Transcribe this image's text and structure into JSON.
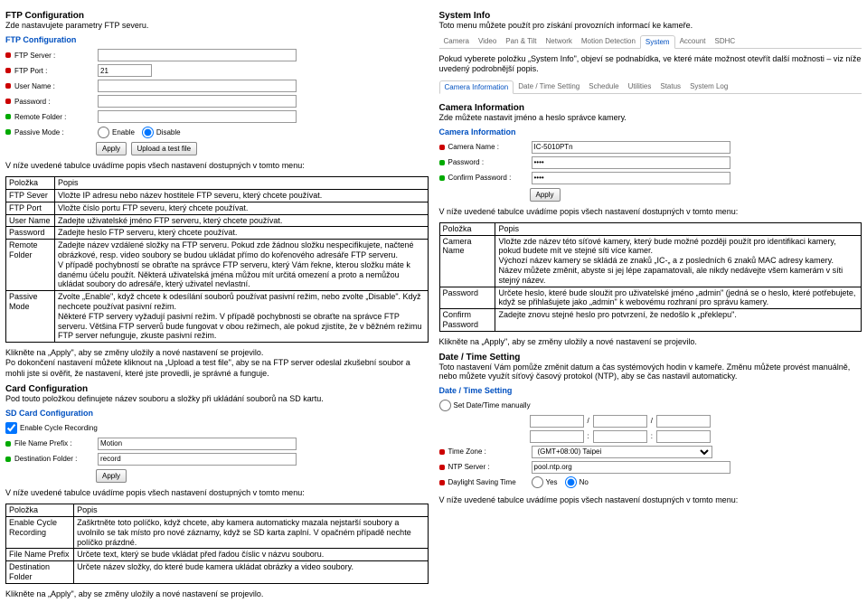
{
  "left": {
    "ftp": {
      "title": "FTP Configuration",
      "sub": "Zde nastavujete parametry FTP severu.",
      "panel": "FTP Configuration",
      "labels": {
        "server": "FTP Server :",
        "port": "FTP Port :",
        "user": "User Name :",
        "password": "Password :",
        "remote": "Remote Folder :",
        "passive": "Passive Mode :"
      },
      "values": {
        "port": "21"
      },
      "radio": {
        "enable": "Enable",
        "disable": "Disable"
      },
      "buttons": {
        "apply": "Apply",
        "test": "Upload a test file"
      },
      "intro": "V níže uvedené tabulce uvádíme popis všech nastavení dostupných v tomto menu:",
      "h_col": "Položka",
      "h_desc": "Popis",
      "rows": [
        [
          "FTP Sever",
          "Vložte IP adresu nebo název hostitele FTP severu, který chcete používat."
        ],
        [
          "FTP Port",
          "Vložte číslo portu FTP severu, který chcete používat."
        ],
        [
          "User Name",
          "Zadejte uživatelské jméno FTP serveru, který chcete používat."
        ],
        [
          "Password",
          "Zadejte heslo FTP serveru, který chcete používat."
        ],
        [
          "Remote Folder",
          "Zadejte název vzdálené složky na FTP serveru. Pokud zde žádnou složku nespecifikujete, načtené obrázkové, resp. video soubory se budou ukládat přímo do kořenového adresáře FTP serveru.\nV případě pochybností se obraťte na správce FTP serveru, který Vám řekne, kterou složku máte k danému účelu použít. Některá uživatelská jména můžou mít určitá omezení a proto a nemůžou ukládat soubory do adresáře, který uživatel nevlastní."
        ],
        [
          "Passive Mode",
          "Zvolte „Enable\", když chcete k odesílání souborů používat pasivní režim, nebo zvolte „Disable\". Když nechcete používat pasivní režim.\nNěkteré FTP servery vyžadují pasivní režim. V případě pochybnosti se obraťte na správce FTP serveru. Většina FTP serverů bude fungovat v obou režimech, ale pokud zjistíte, že v běžném režimu FTP server nefunguje, zkuste pasivní režim."
        ]
      ],
      "footer": "Klikněte na „Apply\", aby se změny uložily a nové nastavení se projevilo.\nPo dokončení nastavení můžete kliknout na „Upload a test file\", aby se na FTP server odeslal zkušební soubor a mohli jste si ověřit, že nastavení, které jste provedli, je správné a funguje."
    },
    "sd": {
      "title": "Card Configuration",
      "sub": "Pod touto položkou definujete název souboru a složky při ukládání souborů na SD kartu.",
      "panel": "SD Card Configuration",
      "check": "Enable Cycle Recording",
      "labels": {
        "prefix": "File Name Prefix :",
        "dest": "Destination Folder :"
      },
      "values": {
        "prefix": "Motion",
        "dest": "record"
      },
      "button": "Apply",
      "intro": "V níže uvedené tabulce uvádíme popis všech nastavení dostupných v tomto menu:",
      "h_col": "Položka",
      "h_desc": "Popis",
      "rows": [
        [
          "Enable Cycle Recording",
          "Zaškrtněte toto políčko, když chcete, aby kamera automaticky mazala nejstarší soubory a uvolnilo se tak místo pro nové záznamy, když se SD karta zaplní. V opačném případě nechte políčko prázdné."
        ],
        [
          "File Name Prefix",
          "Určete text, který se bude vkládat před řadou číslic v názvu souboru."
        ],
        [
          "Destination Folder",
          "Určete název složky, do které bude kamera ukládat obrázky a video soubory."
        ]
      ],
      "footer": "Klikněte na „Apply\", aby se změny uložily a nové nastavení se projevilo."
    }
  },
  "right": {
    "sys": {
      "title": "System Info",
      "sub": "Toto menu můžete použít pro získání provozních informací ke kameře.",
      "tabs1": [
        "Camera",
        "Video",
        "Pan & Tilt",
        "Network",
        "Motion Detection",
        "System",
        "Account",
        "SDHC"
      ],
      "note": "Pokud vyberete položku „System Info\", objeví se podnabídka, ve které máte možnost otevřít další možnosti – viz níže uvedený podrobnější popis.",
      "tabs2": [
        "Camera Information",
        "Date / Time Setting",
        "Schedule",
        "Utilities",
        "Status",
        "System Log"
      ]
    },
    "cam": {
      "title": "Camera Information",
      "sub": "Zde můžete nastavit jméno a heslo správce kamery.",
      "panel": "Camera Information",
      "labels": {
        "name": "Camera Name :",
        "pass": "Password :",
        "confirm": "Confirm Password :"
      },
      "values": {
        "name": "IC-5010PTn",
        "pass": "••••",
        "confirm": "••••"
      },
      "button": "Apply",
      "intro": "V níže uvedené tabulce uvádíme popis všech nastavení dostupných v tomto menu:",
      "h_col": "Položka",
      "h_desc": "Popis",
      "rows": [
        [
          "Camera Name",
          "Vložte zde název této síťové kamery, který bude možné později použít pro identifikaci kamery, pokud budete mít ve stejné síti více kamer.\nVýchozí název kamery se skládá ze znaků „IC-„ a z posledních 6 znaků MAC adresy kamery. Název můžete změnit, abyste si jej lépe zapamatovali, ale nikdy nedávejte všem kamerám v síti stejný název."
        ],
        [
          "Password",
          "Určete heslo, které bude sloužit pro uživatelské jméno „admin\" (jedná se o heslo, které potřebujete, když se přihlašujete jako „admin\" k webovému rozhraní pro správu kamery."
        ],
        [
          "Confirm Password",
          "Zadejte znovu stejné heslo pro potvrzení, že nedošlo k „překlepu\"."
        ]
      ],
      "footer": "Klikněte na „Apply\", aby se změny uložily a nové nastavení se projevilo."
    },
    "dt": {
      "title": "Date / Time Setting",
      "sub": "Toto nastavení Vám pomůže změnit datum a čas systémových hodin v kameře. Změnu můžete provést manuálně, nebo můžete využít síťový časový protokol (NTP), aby se čas nastavil automaticky.",
      "panel": "Date / Time Setting",
      "labels": {
        "manual": "Set Date/Time manually",
        "tz": "Time Zone :",
        "ntp": "NTP Server :",
        "dst": "Daylight Saving Time"
      },
      "tz_val": "(GMT+08:00) Taipei",
      "ntp_val": "pool.ntp.org",
      "yes": "Yes",
      "no": "No",
      "intro": "V níže uvedené tabulce uvádíme popis všech nastavení dostupných v tomto menu:"
    }
  }
}
